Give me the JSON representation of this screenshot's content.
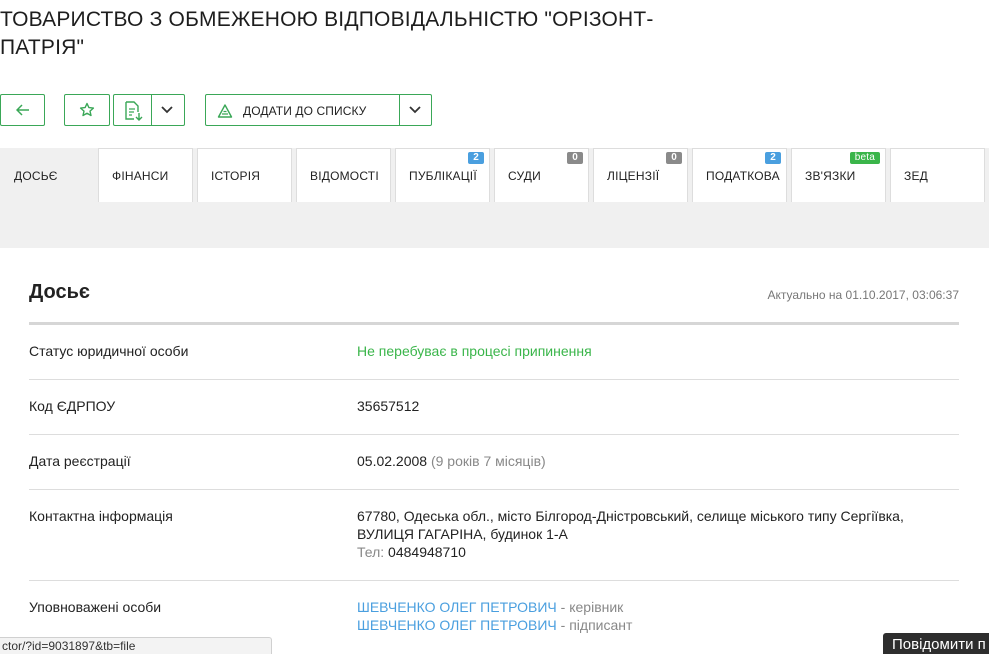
{
  "company": {
    "title": "ТОВАРИСТВО З ОБМЕЖЕНОЮ ВІДПОВІДАЛЬНІСТЮ \"ОРІЗОНТ-ПАТРІЯ\""
  },
  "toolbar": {
    "add_to_list_label": "ДОДАТИ ДО СПИСКУ"
  },
  "tabs": [
    {
      "label": "ДОСЬЄ",
      "badge": ""
    },
    {
      "label": "ФІНАНСИ",
      "badge": ""
    },
    {
      "label": "ІСТОРІЯ",
      "badge": ""
    },
    {
      "label": "ВІДОМОСТІ",
      "badge": ""
    },
    {
      "label": "ПУБЛІКАЦІЇ",
      "badge": "2"
    },
    {
      "label": "СУДИ",
      "badge": "0"
    },
    {
      "label": "ЛІЦЕНЗІЇ",
      "badge": "0"
    },
    {
      "label": "ПОДАТКОВА",
      "badge": "2"
    },
    {
      "label": "ЗВ'ЯЗКИ",
      "badge": "beta"
    },
    {
      "label": "ЗЕД",
      "badge": ""
    }
  ],
  "dossier": {
    "title": "Досьє",
    "updated": "Актуально на 01.10.2017, 03:06:37",
    "rows": {
      "status": {
        "label": "Статус юридичної особи",
        "value": "Не перебуває в процесі припинення"
      },
      "edrpou": {
        "label": "Код ЄДРПОУ",
        "value": "35657512"
      },
      "reg_date": {
        "label": "Дата реєстрації",
        "value": "05.02.2008",
        "age": "(9 років 7 місяців)"
      },
      "contact": {
        "label": "Контактна інформація",
        "address_line1": "67780, Одеська обл., місто Білгород-Дністровський, селище міського типу Сергіївка,",
        "address_line2": "ВУЛИЦЯ ГАГАРІНА, будинок 1-А",
        "phone_label": "Тел:",
        "phone": "0484948710"
      },
      "persons": {
        "label": "Уповноважені особи",
        "list": [
          {
            "name": "ШЕВЧЕНКО ОЛЕГ ПЕТРОВИЧ",
            "role": "- керівник"
          },
          {
            "name": "ШЕВЧЕНКО ОЛЕГ ПЕТРОВИЧ",
            "role": "- підписант"
          }
        ]
      }
    }
  },
  "status_bar": {
    "url": "ctor/?id=9031897&tb=file"
  },
  "report_button": {
    "label": "Повідомити п"
  },
  "colors": {
    "accent": "#3aa757",
    "link": "#4a9fdf",
    "badge_blue": "#4a9fdf",
    "badge_gray": "#8a8a8a",
    "badge_green": "#3ab54a"
  }
}
